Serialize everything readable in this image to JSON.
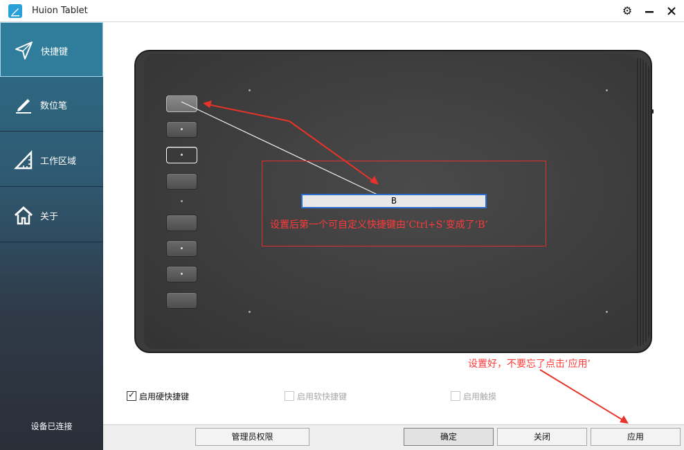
{
  "window": {
    "title": "Huion Tablet"
  },
  "sidebar": {
    "items": [
      {
        "label": "快捷键",
        "icon": "send-arrow-icon"
      },
      {
        "label": "数位笔",
        "icon": "pen-icon"
      },
      {
        "label": "工作区域",
        "icon": "triangle-ruler-icon"
      },
      {
        "label": "关于",
        "icon": "home-icon"
      }
    ],
    "status": "设备已连接"
  },
  "editor": {
    "key_value": "B",
    "annotation": "设置后第一个可自定义快捷键由‘Ctrl+S’变成了‘B’",
    "apply_hint": "设置好，不要忘了点击‘应用’"
  },
  "options": {
    "hardware_keys": {
      "label": "启用硬快捷键",
      "checked": true
    },
    "software_keys": {
      "label": "启用软快捷键",
      "checked": false
    },
    "touch": {
      "label": "启用触摸",
      "checked": false
    }
  },
  "buttons": {
    "admin": "管理员权限",
    "ok": "确定",
    "close": "关闭",
    "apply": "应用"
  },
  "colors": {
    "accent": "#2f7d9a",
    "annotation": "#ff3a3a",
    "focus_border": "#2a6fd0"
  }
}
